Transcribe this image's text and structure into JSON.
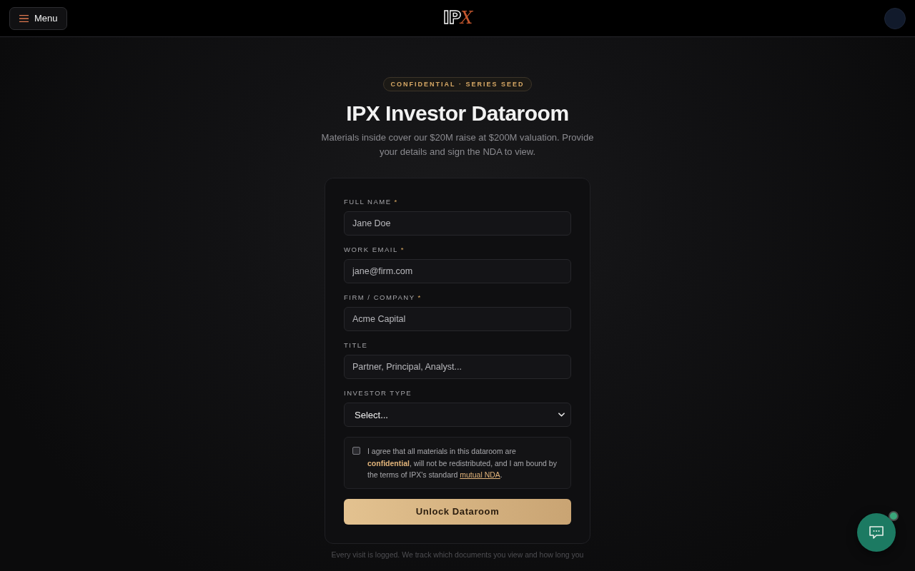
{
  "header": {
    "menu_button": {
      "label": "Menu"
    },
    "logo": {
      "main": "IP",
      "accent": "X"
    }
  },
  "hero": {
    "badge": "CONFIDENTIAL · SERIES SEED",
    "title": "IPX Investor Dataroom",
    "subtitle": "Materials inside cover our $20M raise at $200M valuation. Provide your details and sign the NDA to view."
  },
  "form": {
    "fields": [
      {
        "kind": "text",
        "label": "FULL NAME",
        "required_mark": "*",
        "placeholder": "Jane Doe"
      },
      {
        "kind": "text",
        "label": "WORK EMAIL",
        "required_mark": "*",
        "placeholder": "jane@firm.com"
      },
      {
        "kind": "text",
        "label": "FIRM / COMPANY",
        "required_mark": "*",
        "placeholder": "Acme Capital"
      },
      {
        "kind": "text",
        "label": "TITLE",
        "placeholder": "Partner, Principal, Analyst..."
      },
      {
        "kind": "select",
        "label": "INVESTOR TYPE",
        "value": "Select..."
      }
    ],
    "consent": {
      "checked": false,
      "text": "I agree that all materials in this dataroom are **confidential**, will not be redistributed, and I am bound by the terms of IPX's standard ",
      "link": "mutual NDA",
      "text_end": "."
    },
    "submit": "Unlock Dataroom"
  },
  "footer_note": "Every visit is logged. We track which documents you view and how long you",
  "chat": {
    "online": true
  }
}
